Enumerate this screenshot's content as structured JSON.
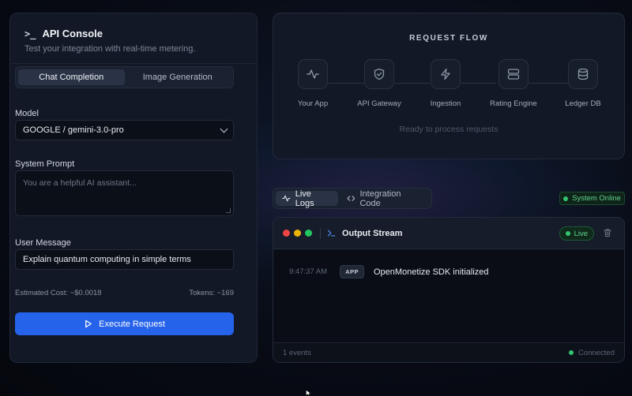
{
  "console": {
    "title": "API Console",
    "title_icon": "terminal-icon",
    "subtitle": "Test your integration with real-time metering.",
    "tabs": [
      {
        "label": "Chat Completion",
        "active": true
      },
      {
        "label": "Image Generation",
        "active": false
      }
    ],
    "model_label": "Model",
    "model_value": "GOOGLE / gemini-3.0-pro",
    "system_prompt_label": "System Prompt",
    "system_prompt_placeholder": "You are a helpful AI assistant...",
    "user_message_label": "User Message",
    "user_message_value": "Explain quantum computing in simple terms",
    "estimated_cost": "Estimated Cost: ~$0.0018",
    "tokens": "Tokens: ~169",
    "execute_label": "Execute Request",
    "accent_color": "#2563eb"
  },
  "flow": {
    "title": "REQUEST FLOW",
    "nodes": [
      {
        "label": "Your App",
        "icon": "activity-icon"
      },
      {
        "label": "API Gateway",
        "icon": "shield-icon"
      },
      {
        "label": "Ingestion",
        "icon": "lightning-icon"
      },
      {
        "label": "Rating Engine",
        "icon": "server-icon"
      },
      {
        "label": "Ledger DB",
        "icon": "database-icon"
      }
    ],
    "status": "Ready to process requests"
  },
  "logs": {
    "tabs": [
      {
        "label": "Live Logs",
        "icon": "activity-icon",
        "active": true
      },
      {
        "label": "Integration Code",
        "icon": "code-icon",
        "active": false
      }
    ],
    "system_status": "System Online",
    "status_color": "#34c46f"
  },
  "stream": {
    "title": "Output Stream",
    "live_label": "Live",
    "entries": [
      {
        "time": "9:47:37 AM",
        "source": "APP",
        "message": "OpenMonetize SDK initialized"
      }
    ],
    "event_count": "1 events",
    "connection": "Connected"
  }
}
